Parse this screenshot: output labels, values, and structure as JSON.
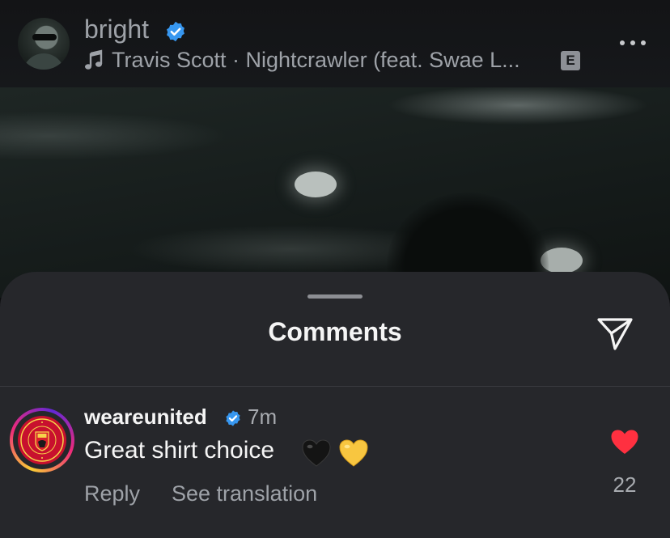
{
  "story_header": {
    "username": "bright",
    "verified": true,
    "music_icon": "music-note-icon",
    "track": "Travis Scott · Nightcrawler (feat. Swae L...",
    "explicit_badge": "E",
    "more_icon": "more-horizontal-icon"
  },
  "comments_sheet": {
    "title": "Comments",
    "share_icon": "send-icon"
  },
  "comments": [
    {
      "username": "weareunited",
      "verified": true,
      "time": "7m",
      "text": "Great shirt choice",
      "emojis": [
        "black-heart",
        "yellow-heart"
      ],
      "reply_label": "Reply",
      "translate_label": "See translation",
      "like_icon": "heart-icon",
      "liked": true,
      "like_count": "22"
    }
  ],
  "colors": {
    "verified_blue": "#3797f0",
    "like_red": "#ff3040",
    "sheet_bg": "#26272b",
    "crest_red": "#c8102e"
  }
}
